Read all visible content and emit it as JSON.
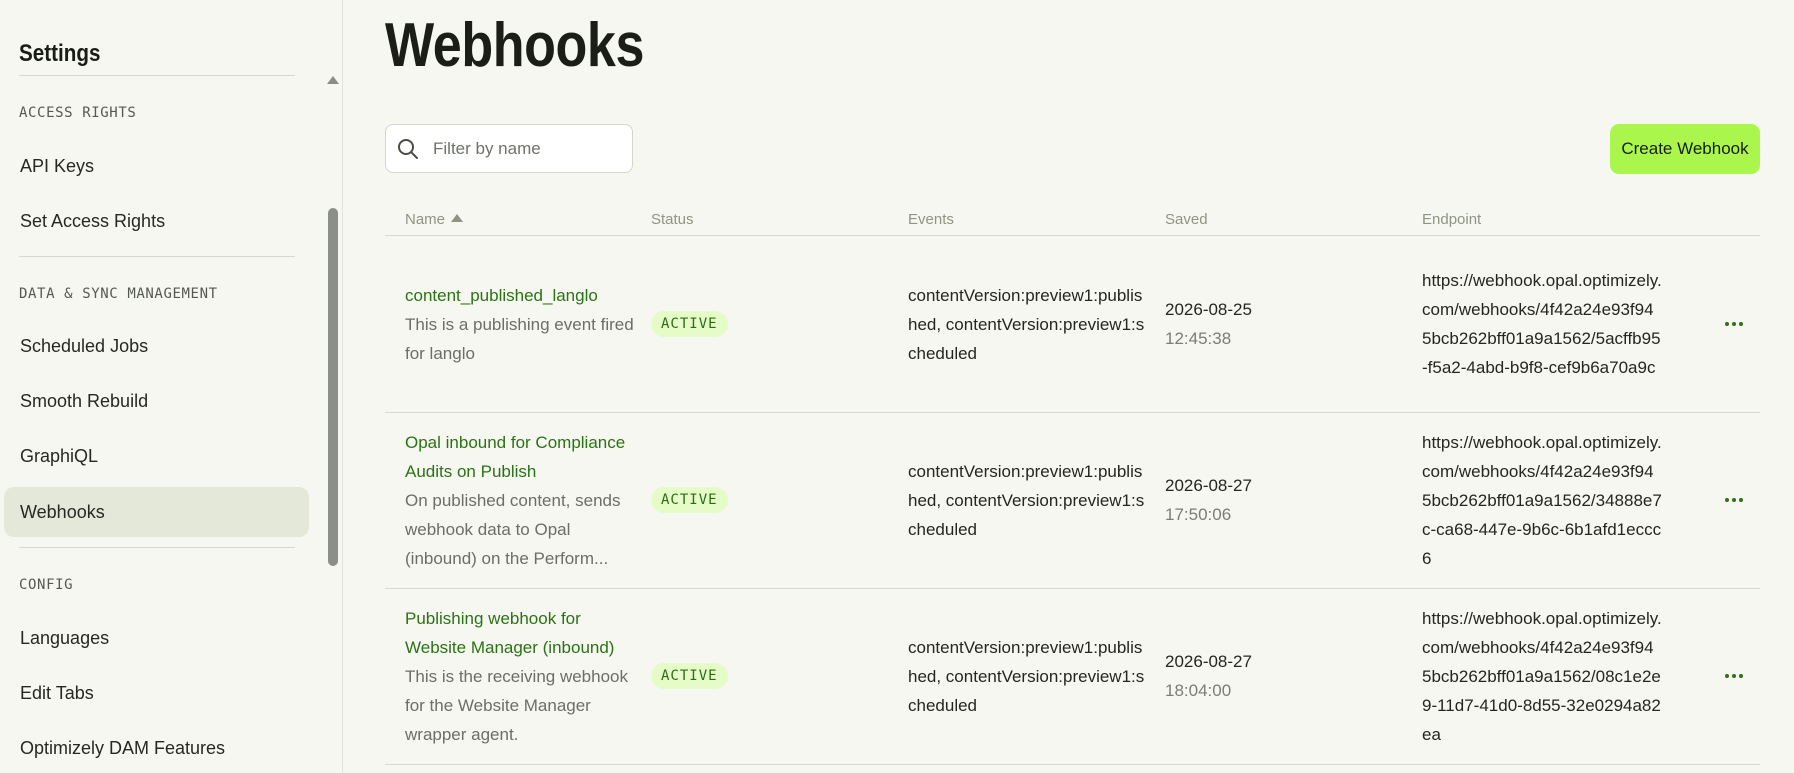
{
  "sidebar": {
    "title": "Settings",
    "sections": [
      {
        "label": "ACCESS RIGHTS",
        "items": [
          "API Keys",
          "Set Access Rights"
        ]
      },
      {
        "label": "DATA & SYNC MANAGEMENT",
        "items": [
          "Scheduled Jobs",
          "Smooth Rebuild",
          "GraphiQL",
          "Webhooks"
        ]
      },
      {
        "label": "CONFIG",
        "items": [
          "Languages",
          "Edit Tabs",
          "Optimizely DAM Features"
        ]
      }
    ],
    "active_item": "Webhooks"
  },
  "main": {
    "title": "Webhooks",
    "search": {
      "placeholder": "Filter by name",
      "value": ""
    },
    "create_button": "Create Webhook",
    "columns": {
      "name": "Name",
      "status": "Status",
      "events": "Events",
      "saved": "Saved",
      "endpoint": "Endpoint"
    },
    "sort": {
      "column": "Name",
      "direction": "ascending"
    },
    "rows": [
      {
        "name": "content_published_langlo",
        "description": "This is a publishing event fired for langlo",
        "status": "ACTIVE",
        "events": "contentVersion:preview1:published, contentVersion:preview1:scheduled",
        "saved_date": "2026-08-25",
        "saved_time": "12:45:38",
        "endpoint": "https://webhook.opal.optimizely.com/webhooks/4f42a24e93f945bcb262bff01a9a1562/5acffb95-f5a2-4abd-b9f8-cef9b6a70a9c"
      },
      {
        "name": "Opal inbound for Compliance Audits on Publish",
        "description": "On published content, sends webhook data to Opal (inbound) on the Perform...",
        "status": "ACTIVE",
        "events": "contentVersion:preview1:published, contentVersion:preview1:scheduled",
        "saved_date": "2026-08-27",
        "saved_time": "17:50:06",
        "endpoint": "https://webhook.opal.optimizely.com/webhooks/4f42a24e93f945bcb262bff01a9a1562/34888e7c-ca68-447e-9b6c-6b1afd1eccc6"
      },
      {
        "name": "Publishing webhook for Website Manager (inbound)",
        "description": "This is the receiving webhook for the Website Manager wrapper agent.",
        "status": "ACTIVE",
        "events": "contentVersion:preview1:published, contentVersion:preview1:scheduled",
        "saved_date": "2026-08-27",
        "saved_time": "18:04:00",
        "endpoint": "https://webhook.opal.optimizely.com/webhooks/4f42a24e93f945bcb262bff01a9a1562/08c1e2e9-11d7-41d0-8d55-32e0294a82ea"
      }
    ]
  },
  "icons": {
    "search": "search-icon",
    "row_menu": "more-horizontal-icon",
    "sort": "sort-ascending-icon",
    "scroll_up": "scroll-up-arrow-icon"
  },
  "colors": {
    "accent": "#abf64c",
    "link": "#2a7314",
    "badge_bg": "#e5fbc8",
    "active_item_bg": "#e4e8d8"
  }
}
